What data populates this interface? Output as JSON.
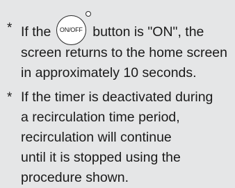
{
  "notes": [
    {
      "bullet": "*",
      "before_icon": "If the",
      "icon": {
        "name": "on-off-button-icon",
        "label": "ON/OFF"
      },
      "after_icon": "button is \"ON\", the",
      "lines": [
        "screen returns to the home screen",
        "in approximately 10 seconds."
      ]
    },
    {
      "bullet": "*",
      "lines": [
        "If the timer is deactivated during",
        "a recirculation time period,",
        "recirculation will continue",
        "until it is stopped using the",
        "procedure shown."
      ]
    }
  ]
}
